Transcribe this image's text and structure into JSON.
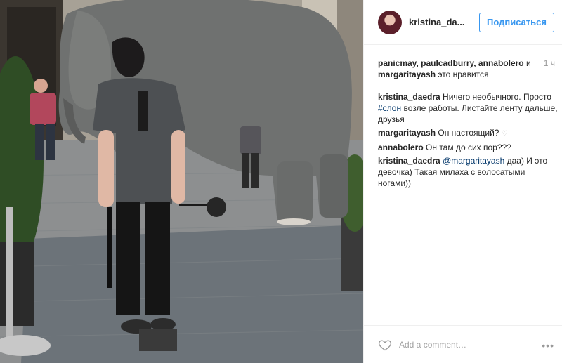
{
  "photo": {
    "alt_icon": "photo-elephant-scene"
  },
  "header": {
    "username": "kristina_da...",
    "follow_label": "Подписаться"
  },
  "likes": {
    "names": "panicmay, paulcadburry, annabolero",
    "connector": " и ",
    "last_name": "margaritayash",
    "suffix": " это нравится",
    "time": "1 ч"
  },
  "comments": [
    {
      "author": "kristina_daedra",
      "text_before": " Ничего необычного. Просто ",
      "hashtag": "#слон",
      "text_after": " возле работы. Листайте ленту дальше, друзья"
    },
    {
      "author": "margaritayash",
      "text": " Он настоящий?"
    },
    {
      "author": "annabolero",
      "text": " Он там до сих пор???"
    },
    {
      "author": "kristina_daedra",
      "mention": "@margaritayash",
      "text": " даа) И это девочка) Такая милаха с волосатыми ногами))"
    }
  ],
  "footer": {
    "placeholder": "Add a comment…",
    "more": "•••"
  },
  "colors": {
    "accent": "#3897f0",
    "link": "#003569",
    "text": "#262626",
    "muted": "#999999"
  },
  "icons": {
    "like": "heart-outline-icon",
    "more": "ellipsis-icon"
  }
}
